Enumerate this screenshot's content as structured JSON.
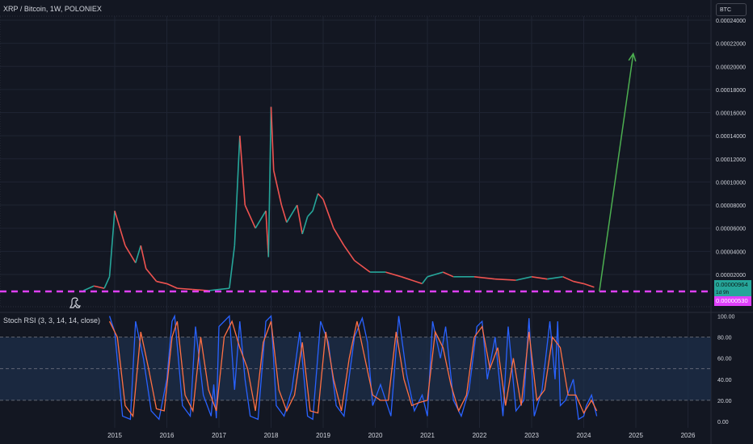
{
  "header": {
    "title": "XRP / Bitcoin, 1W, POLONIEX",
    "currency": "BTC"
  },
  "price_tags": {
    "current": "0.00000964",
    "countdown": "1d 9h",
    "line": "0.00000530"
  },
  "rsi_panel": {
    "label": "Stoch RSI (3, 3, 14, 14, close)"
  },
  "colors": {
    "background": "#131722",
    "grid": "#1f2433",
    "up": "#26a69a",
    "down": "#ef5350",
    "support_line": "#e040fb",
    "projection_arrow": "#4caf50",
    "k_line": "#2962ff",
    "d_line": "#ff7043",
    "rsi_band": "#1e2f4a"
  },
  "chart_data": [
    {
      "type": "line",
      "title": "XRP / Bitcoin, 1W, POLONIEX",
      "x_ticks": [
        "2015",
        "2016",
        "2017",
        "2018",
        "2019",
        "2020",
        "2021",
        "2022",
        "2023",
        "2024",
        "2025",
        "2026"
      ],
      "y_ticks": [
        "0.00002000",
        "0.00004000",
        "0.00006000",
        "0.00008000",
        "0.00010000",
        "0.00012000",
        "0.00014000",
        "0.00016000",
        "0.00018000",
        "0.00020000",
        "0.00022000",
        "0.00024000"
      ],
      "ylim": [
        0,
        0.000245
      ],
      "xlim": [
        2014.0,
        2026.6
      ],
      "grid": true,
      "series": [
        {
          "x": [
            2014.4,
            2014.6,
            2014.8,
            2014.9,
            2015.0,
            2015.1,
            2015.2,
            2015.4,
            2015.5,
            2015.6,
            2015.8,
            2016.0,
            2016.2,
            2016.5,
            2016.8,
            2017.0,
            2017.2,
            2017.3,
            2017.4,
            2017.45,
            2017.5,
            2017.7,
            2017.9,
            2017.95,
            2018.0,
            2018.05,
            2018.2,
            2018.3,
            2018.5,
            2018.6,
            2018.7,
            2018.8,
            2018.9,
            2019.0,
            2019.2,
            2019.4,
            2019.6,
            2019.9,
            2020.2,
            2020.5,
            2020.9,
            2021.0,
            2021.3,
            2021.5,
            2021.9,
            2022.3,
            2022.7,
            2023.0,
            2023.3,
            2023.6,
            2023.8,
            2024.0,
            2024.2
          ],
          "values": [
            6e-06,
            1e-05,
            8e-06,
            1.8e-05,
            7.5e-05,
            6e-05,
            4.5e-05,
            3e-05,
            4.5e-05,
            2.5e-05,
            1.4e-05,
            1.2e-05,
            8e-06,
            7e-06,
            6e-06,
            7e-06,
            8e-06,
            4.5e-05,
            0.00014,
            0.00011,
            8e-05,
            6e-05,
            7.5e-05,
            3.5e-05,
            0.000165,
            0.00011,
            8e-05,
            6.5e-05,
            8e-05,
            5.5e-05,
            7e-05,
            7.5e-05,
            9e-05,
            8.5e-05,
            6e-05,
            4.5e-05,
            3.2e-05,
            2.2e-05,
            2.2e-05,
            1.8e-05,
            1.2e-05,
            1.8e-05,
            2.2e-05,
            1.8e-05,
            1.8e-05,
            1.6e-05,
            1.5e-05,
            1.8e-05,
            1.6e-05,
            1.8e-05,
            1.4e-05,
            1.2e-05,
            9e-06
          ]
        }
      ],
      "annotations": {
        "support_level": 5.3e-06,
        "projection_arrow": {
          "from": [
            2024.3,
            5.3e-06
          ],
          "to": [
            2024.95,
            0.000211
          ]
        }
      }
    },
    {
      "type": "line",
      "title": "Stoch RSI (3, 3, 14, 14, close)",
      "ylim": [
        0,
        100
      ],
      "y_ticks": [
        "100.00",
        "80.00",
        "60.00",
        "40.00",
        "20.00",
        "0.00"
      ],
      "bands": [
        20,
        50,
        80
      ],
      "series": [
        {
          "name": "K",
          "x": [
            2014.9,
            2015.0,
            2015.15,
            2015.3,
            2015.4,
            2015.55,
            2015.7,
            2015.85,
            2016.0,
            2016.1,
            2016.15,
            2016.3,
            2016.45,
            2016.55,
            2016.7,
            2016.85,
            2016.9,
            2016.95,
            2017.0,
            2017.2,
            2017.3,
            2017.4,
            2017.5,
            2017.6,
            2017.75,
            2017.9,
            2018.0,
            2018.1,
            2018.25,
            2018.4,
            2018.55,
            2018.7,
            2018.8,
            2018.95,
            2019.1,
            2019.25,
            2019.4,
            2019.6,
            2019.75,
            2019.85,
            2019.95,
            2020.1,
            2020.3,
            2020.45,
            2020.6,
            2020.75,
            2020.9,
            2021.0,
            2021.1,
            2021.25,
            2021.35,
            2021.5,
            2021.65,
            2021.8,
            2021.95,
            2022.05,
            2022.15,
            2022.3,
            2022.45,
            2022.55,
            2022.7,
            2022.85,
            2022.95,
            2023.05,
            2023.2,
            2023.35,
            2023.45,
            2023.5,
            2023.55,
            2023.65,
            2023.8,
            2023.9,
            2024.0,
            2024.05,
            2024.15,
            2024.25
          ],
          "values": [
            100,
            85,
            5,
            2,
            95,
            60,
            10,
            2,
            40,
            95,
            100,
            15,
            5,
            90,
            25,
            5,
            35,
            3,
            90,
            100,
            30,
            95,
            40,
            5,
            2,
            95,
            100,
            15,
            5,
            30,
            85,
            5,
            2,
            95,
            75,
            15,
            5,
            80,
            98,
            75,
            15,
            35,
            5,
            100,
            45,
            10,
            25,
            5,
            95,
            60,
            90,
            20,
            5,
            30,
            90,
            95,
            40,
            80,
            5,
            90,
            10,
            20,
            98,
            5,
            30,
            95,
            40,
            95,
            15,
            20,
            40,
            2,
            5,
            15,
            25,
            5
          ]
        },
        {
          "name": "D",
          "x": [
            2014.9,
            2015.05,
            2015.2,
            2015.35,
            2015.5,
            2015.65,
            2015.8,
            2015.95,
            2016.1,
            2016.2,
            2016.35,
            2016.5,
            2016.65,
            2016.8,
            2016.95,
            2017.1,
            2017.25,
            2017.4,
            2017.55,
            2017.7,
            2017.85,
            2018.0,
            2018.15,
            2018.3,
            2018.45,
            2018.6,
            2018.75,
            2018.9,
            2019.05,
            2019.2,
            2019.35,
            2019.5,
            2019.65,
            2019.8,
            2019.95,
            2020.1,
            2020.25,
            2020.4,
            2020.55,
            2020.7,
            2020.85,
            2021.0,
            2021.15,
            2021.3,
            2021.45,
            2021.6,
            2021.75,
            2021.9,
            2022.05,
            2022.2,
            2022.35,
            2022.5,
            2022.65,
            2022.8,
            2022.95,
            2023.1,
            2023.25,
            2023.4,
            2023.55,
            2023.7,
            2023.85,
            2024.0,
            2024.15,
            2024.25
          ],
          "values": [
            95,
            80,
            15,
            5,
            85,
            50,
            12,
            10,
            80,
            95,
            25,
            10,
            80,
            30,
            10,
            80,
            95,
            70,
            50,
            10,
            75,
            95,
            30,
            10,
            25,
            75,
            10,
            8,
            85,
            40,
            10,
            60,
            95,
            60,
            25,
            20,
            20,
            85,
            40,
            15,
            18,
            20,
            85,
            70,
            35,
            10,
            25,
            80,
            90,
            50,
            70,
            15,
            60,
            15,
            85,
            20,
            30,
            80,
            70,
            25,
            25,
            8,
            20,
            10
          ]
        }
      ]
    }
  ]
}
